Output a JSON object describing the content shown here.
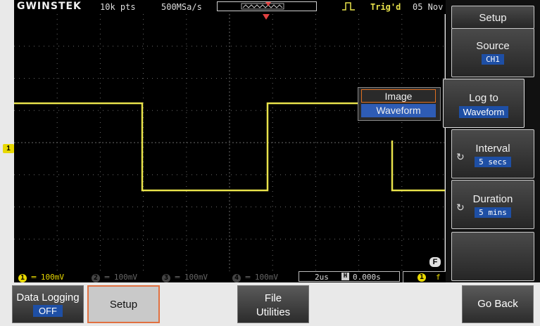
{
  "topbar": {
    "brand": "GWINSTEK",
    "record_length": "10k pts",
    "sample_rate": "500MSa/s",
    "trigger_status": "Trig'd",
    "date": "05 Nov"
  },
  "channel_marker": "1",
  "popup": {
    "options": [
      "Image",
      "Waveform"
    ],
    "selected": "Waveform"
  },
  "statusbar": {
    "ch1": {
      "num": "1",
      "scale": "100mV"
    },
    "ch2": {
      "num": "2",
      "scale": "100mV"
    },
    "ch3": {
      "num": "3",
      "scale": "100mV"
    },
    "ch4": {
      "num": "4",
      "scale": "100mV"
    },
    "time_div": "2us",
    "h_label": "H",
    "h_position": "0.000s",
    "trigger_source": "1",
    "trigger_edge": "f"
  },
  "f_marker": "F",
  "side_menu": {
    "title": "Setup",
    "source": {
      "label": "Source",
      "value": "CH1"
    },
    "log_to": {
      "label": "Log to",
      "value": "Waveform"
    },
    "interval": {
      "label": "Interval",
      "value": "5 secs"
    },
    "duration": {
      "label": "Duration",
      "value": "5 mins"
    }
  },
  "bottom_keys": {
    "data_logging": {
      "label": "Data Logging",
      "value": "OFF"
    },
    "setup": "Setup",
    "file_utilities": [
      "File",
      "Utilities"
    ],
    "go_back": "Go Back"
  },
  "colors": {
    "trace": "#e8e24b",
    "ch1": "#e8d800",
    "highlight": "#2e5cb5",
    "selection_border": "#e07020"
  }
}
